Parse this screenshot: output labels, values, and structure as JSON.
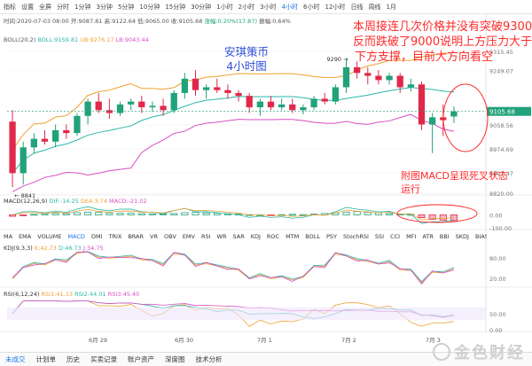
{
  "toolbar": {
    "items": [
      "指标",
      "设置",
      "全屏",
      "分时",
      "1分钟",
      "3分钟",
      "5分钟",
      "10分钟",
      "15分钟",
      "30分钟",
      "1小时",
      "2小时",
      "3小时",
      "4小时",
      "6小时",
      "12小时",
      "日线",
      "周线",
      "1月"
    ],
    "active": "4小时"
  },
  "info": {
    "time": "时间:2020-07-03 08:00",
    "open": "开:9087.81",
    "high": "高:9122.64",
    "low": "低:9065.00",
    "close": "收:9105.68",
    "change": "涨幅:0.20%(17.87)",
    "amplitude": "振幅:0.64%"
  },
  "boll": {
    "name": "BOLL(20,2)",
    "boll": "BOLL:9159.81",
    "ub": "UB:9276.17",
    "lb": "LB:9043.44"
  },
  "macd": {
    "name": "MACD(12,26,9)",
    "dif": "DIF:-14.25",
    "dea": "DEA:3.74",
    "macd": "MACD:-21.02"
  },
  "kdj": {
    "name": "KDJ(9,3,3)",
    "k": "K:42.73",
    "d": "D:46.73",
    "j": "J:34.75"
  },
  "rsi": {
    "name": "RSI(6,12,24)",
    "rsi1": "RSI1:41.13",
    "rsi2": "RSI2:44.01",
    "rsi3": "RSI3:45.40"
  },
  "indicator_tabs": [
    "MA",
    "EMA",
    "VOLUME",
    "MACD",
    "DMI",
    "TRIX",
    "BRAR",
    "VR",
    "OBV",
    "EMV",
    "RSI",
    "WR",
    "SAR",
    "KDJ",
    "ROC",
    "MTM",
    "BOLL",
    "PSY",
    "StochRSI",
    "SSI",
    "CCI",
    "MFI",
    "ATR",
    "BBI",
    "SKDJ",
    "BIAS",
    "DPO",
    "AO",
    "Position"
  ],
  "active_indicator": "MACD",
  "bottom_tabs": [
    "未成交",
    "计划单",
    "历史",
    "买卖记录",
    "账户资产",
    "深度图",
    "技术分析"
  ],
  "annotations": {
    "title_line1": "安琪策币",
    "title_line2": "4小时图",
    "main_line1": "本周接连几次价格并没有突破9300",
    "main_line2": "反而跌破了9000说明上方压力大于",
    "main_line3": "下方支撑，目前大方向看空",
    "macd_line1": "附图MACD呈现死叉状态",
    "macd_line2": "运行"
  },
  "watermark": "金色财经",
  "colors": {
    "up": "#21a27a",
    "down": "#e0294a",
    "boll_mid": "#2ab7a9",
    "boll_ub": "#f0a030",
    "boll_lb": "#d84ec2",
    "annotation": "#ff2a2a",
    "title": "#2c4fd6"
  },
  "chart_data": {
    "type": "candlestick",
    "title": "",
    "price_axis_ticks": [
      9315.45,
      9249.07,
      9105.68,
      9058.56,
      8974.69,
      8891.47,
      8820.0
    ],
    "current_price": 9105.68,
    "high_marker": 9290,
    "low_marker": 8841,
    "date_labels": [
      "6月 29",
      "6月 30",
      "7月 1",
      "7月 2",
      "7月 3"
    ],
    "candles": [
      {
        "o": 9070,
        "h": 9110,
        "l": 8841,
        "c": 8890
      },
      {
        "o": 8890,
        "h": 9000,
        "l": 8850,
        "c": 8980
      },
      {
        "o": 8980,
        "h": 9030,
        "l": 8960,
        "c": 9010
      },
      {
        "o": 9010,
        "h": 9040,
        "l": 8990,
        "c": 9000
      },
      {
        "o": 9000,
        "h": 9060,
        "l": 8980,
        "c": 9040
      },
      {
        "o": 9040,
        "h": 9060,
        "l": 9010,
        "c": 9030
      },
      {
        "o": 9030,
        "h": 9100,
        "l": 9020,
        "c": 9090
      },
      {
        "o": 9090,
        "h": 9150,
        "l": 9060,
        "c": 9140
      },
      {
        "o": 9140,
        "h": 9170,
        "l": 9100,
        "c": 9110
      },
      {
        "o": 9110,
        "h": 9150,
        "l": 9080,
        "c": 9100
      },
      {
        "o": 9100,
        "h": 9140,
        "l": 9090,
        "c": 9130
      },
      {
        "o": 9130,
        "h": 9150,
        "l": 9110,
        "c": 9140
      },
      {
        "o": 9140,
        "h": 9160,
        "l": 9100,
        "c": 9120
      },
      {
        "o": 9120,
        "h": 9140,
        "l": 9105,
        "c": 9125
      },
      {
        "o": 9125,
        "h": 9150,
        "l": 9090,
        "c": 9110
      },
      {
        "o": 9110,
        "h": 9180,
        "l": 9100,
        "c": 9170
      },
      {
        "o": 9170,
        "h": 9240,
        "l": 9150,
        "c": 9220
      },
      {
        "o": 9220,
        "h": 9250,
        "l": 9160,
        "c": 9180
      },
      {
        "o": 9180,
        "h": 9200,
        "l": 9150,
        "c": 9190
      },
      {
        "o": 9190,
        "h": 9220,
        "l": 9170,
        "c": 9180
      },
      {
        "o": 9180,
        "h": 9200,
        "l": 9150,
        "c": 9170
      },
      {
        "o": 9170,
        "h": 9180,
        "l": 9140,
        "c": 9160
      },
      {
        "o": 9160,
        "h": 9170,
        "l": 9100,
        "c": 9120
      },
      {
        "o": 9120,
        "h": 9150,
        "l": 9090,
        "c": 9140
      },
      {
        "o": 9140,
        "h": 9160,
        "l": 9110,
        "c": 9120
      },
      {
        "o": 9120,
        "h": 9150,
        "l": 9110,
        "c": 9130
      },
      {
        "o": 9130,
        "h": 9150,
        "l": 9100,
        "c": 9110
      },
      {
        "o": 9110,
        "h": 9130,
        "l": 9095,
        "c": 9120
      },
      {
        "o": 9120,
        "h": 9160,
        "l": 9110,
        "c": 9150
      },
      {
        "o": 9150,
        "h": 9170,
        "l": 9130,
        "c": 9140
      },
      {
        "o": 9140,
        "h": 9200,
        "l": 9130,
        "c": 9190
      },
      {
        "o": 9190,
        "h": 9290,
        "l": 9170,
        "c": 9260
      },
      {
        "o": 9260,
        "h": 9280,
        "l": 9220,
        "c": 9240
      },
      {
        "o": 9240,
        "h": 9260,
        "l": 9200,
        "c": 9230
      },
      {
        "o": 9230,
        "h": 9250,
        "l": 9200,
        "c": 9215
      },
      {
        "o": 9215,
        "h": 9240,
        "l": 9200,
        "c": 9230
      },
      {
        "o": 9230,
        "h": 9240,
        "l": 9170,
        "c": 9190
      },
      {
        "o": 9190,
        "h": 9220,
        "l": 9175,
        "c": 9200
      },
      {
        "o": 9200,
        "h": 9210,
        "l": 9040,
        "c": 9060
      },
      {
        "o": 9060,
        "h": 9100,
        "l": 8960,
        "c": 9085
      },
      {
        "o": 9085,
        "h": 9130,
        "l": 9020,
        "c": 9075
      },
      {
        "o": 9087.81,
        "h": 9122.64,
        "l": 9065.0,
        "c": 9105.68
      }
    ],
    "ylim": [
      8820,
      9340
    ],
    "macd_ylim": [
      -40,
      40
    ],
    "macd_bars": [
      -5,
      -3,
      2,
      4,
      6,
      5,
      8,
      10,
      9,
      7,
      6,
      6,
      5,
      4,
      3,
      5,
      8,
      9,
      7,
      6,
      4,
      3,
      1,
      0,
      -1,
      1,
      2,
      1,
      3,
      5,
      7,
      10,
      12,
      9,
      7,
      5,
      3,
      2,
      -10,
      -16,
      -19,
      -21.02
    ],
    "kdj_ylim": [
      0,
      100
    ],
    "rsi_ylim": [
      0,
      100
    ]
  }
}
